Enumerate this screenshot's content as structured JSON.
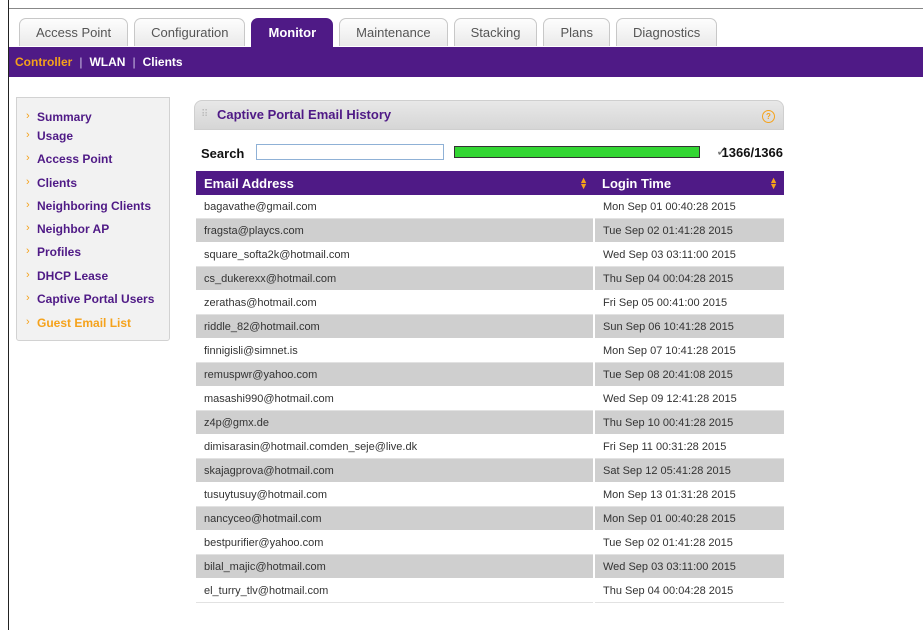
{
  "tabs": [
    "Access Point",
    "Configuration",
    "Monitor",
    "Maintenance",
    "Stacking",
    "Plans",
    "Diagnostics"
  ],
  "active_tab": "Monitor",
  "subnav": [
    "Controller",
    "WLAN",
    "Clients"
  ],
  "active_subnav": "Controller",
  "menu": [
    "Summary",
    "Usage",
    "Access Point",
    "Clients",
    "Neighboring Clients",
    "Neighbor AP",
    "Profiles",
    "DHCP Lease",
    "Captive Portal Users",
    "Guest Email List"
  ],
  "active_menu": "Guest Email List",
  "panel": {
    "title": "Captive Portal Email History",
    "search_label": "Search",
    "search_value": "",
    "progress_fraction": 1.0,
    "count": "1366/1366"
  },
  "table": {
    "headers": [
      "Email Address",
      "Login Time"
    ],
    "rows": [
      [
        "bagavathe@gmail.com",
        "Mon Sep 01 00:40:28 2015"
      ],
      [
        "fragsta@playcs.com",
        "Tue Sep 02 01:41:28 2015"
      ],
      [
        "square_softa2k@hotmail.com",
        "Wed Sep 03 03:11:00 2015"
      ],
      [
        "cs_dukerexx@hotmail.com",
        "Thu Sep 04 00:04:28 2015"
      ],
      [
        "zerathas@hotmail.com",
        "Fri Sep 05 00:41:00 2015"
      ],
      [
        "riddle_82@hotmail.com",
        "Sun Sep 06 10:41:28 2015"
      ],
      [
        "finnigisli@simnet.is",
        "Mon Sep 07 10:41:28 2015"
      ],
      [
        "remuspwr@yahoo.com",
        "Tue Sep 08 20:41:08 2015"
      ],
      [
        "masashi990@hotmail.com",
        "Wed Sep 09 12:41:28 2015"
      ],
      [
        "z4p@gmx.de",
        "Thu Sep 10 00:41:28 2015"
      ],
      [
        "dimisarasin@hotmail.comden_seje@live.dk",
        "Fri Sep 11 00:31:28 2015"
      ],
      [
        "skajagprova@hotmail.com",
        "Sat Sep 12 05:41:28 2015"
      ],
      [
        "tusuytusuy@hotmail.com",
        "Mon Sep 13 01:31:28 2015"
      ],
      [
        "nancyceo@hotmail.com",
        "Mon Sep 01 00:40:28 2015"
      ],
      [
        "bestpurifier@yahoo.com",
        "Tue Sep 02 01:41:28 2015"
      ],
      [
        "bilal_majic@hotmail.com",
        "Wed Sep 03 03:11:00 2015"
      ],
      [
        "el_turry_tlv@hotmail.com",
        "Thu Sep 04 00:04:28 2015"
      ]
    ]
  },
  "colors": {
    "brand_purple": "#4f1a86",
    "accent_orange": "#f5a21b",
    "progress_green": "#33d633"
  }
}
